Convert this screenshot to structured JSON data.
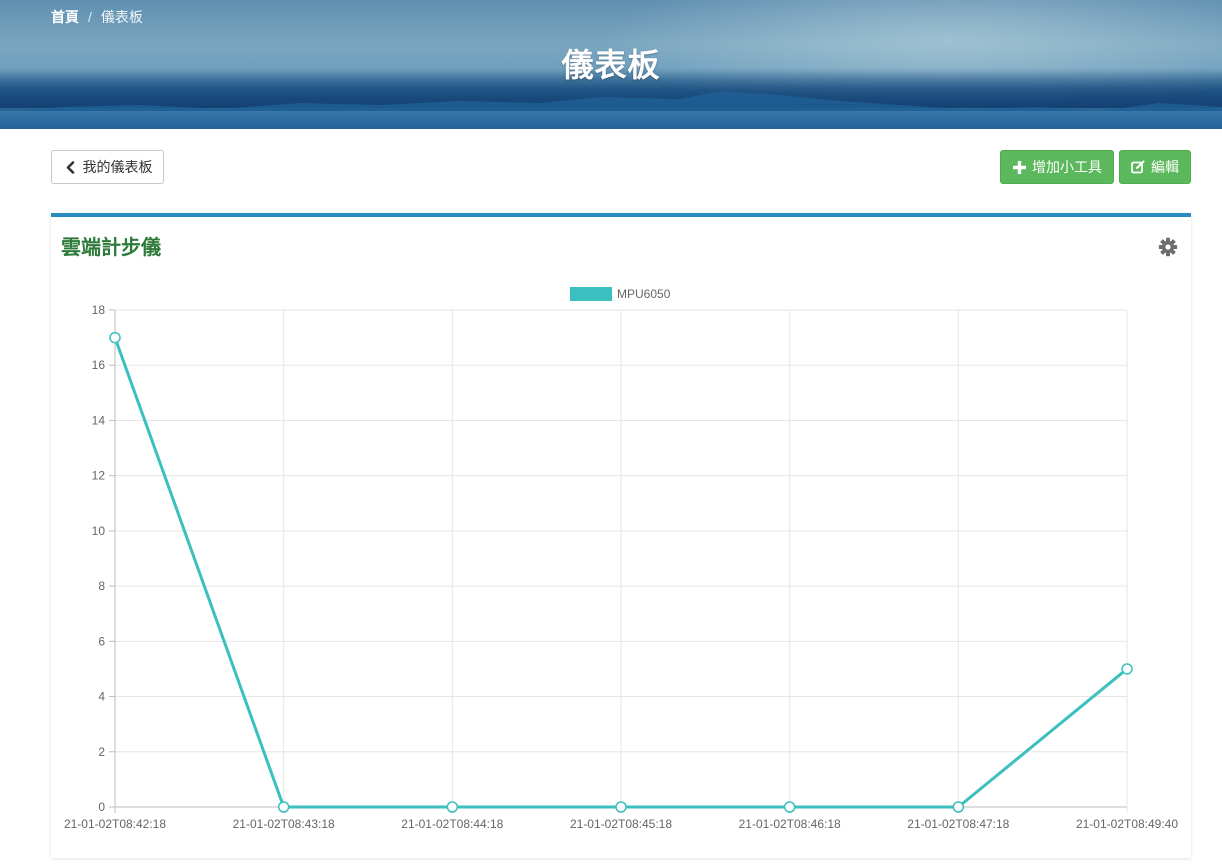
{
  "breadcrumb": {
    "home": "首頁",
    "separator": "/",
    "current": "儀表板"
  },
  "hero": {
    "title": "儀表板"
  },
  "toolbar": {
    "back_label": "我的儀表板",
    "add_widget_label": "增加小工具",
    "edit_label": "編輯"
  },
  "widget": {
    "title": "雲端計步儀",
    "settings_icon": "gear-icon"
  },
  "colors": {
    "accent_border": "#2a8ac2",
    "success": "#5cb85c",
    "widget_title": "#2d7a3a",
    "series": "#3bbfbf"
  },
  "chart_data": {
    "type": "line",
    "legend_position": "top-center",
    "grid": true,
    "x": [
      "21-01-02T08:42:18",
      "21-01-02T08:43:18",
      "21-01-02T08:44:18",
      "21-01-02T08:45:18",
      "21-01-02T08:46:18",
      "21-01-02T08:47:18",
      "21-01-02T08:49:40"
    ],
    "series": [
      {
        "name": "MPU6050",
        "values": [
          17,
          0,
          0,
          0,
          0,
          0,
          5
        ]
      }
    ],
    "yticks": [
      0,
      2,
      4,
      6,
      8,
      10,
      12,
      14,
      16,
      18
    ],
    "ylim": [
      0,
      18
    ]
  }
}
